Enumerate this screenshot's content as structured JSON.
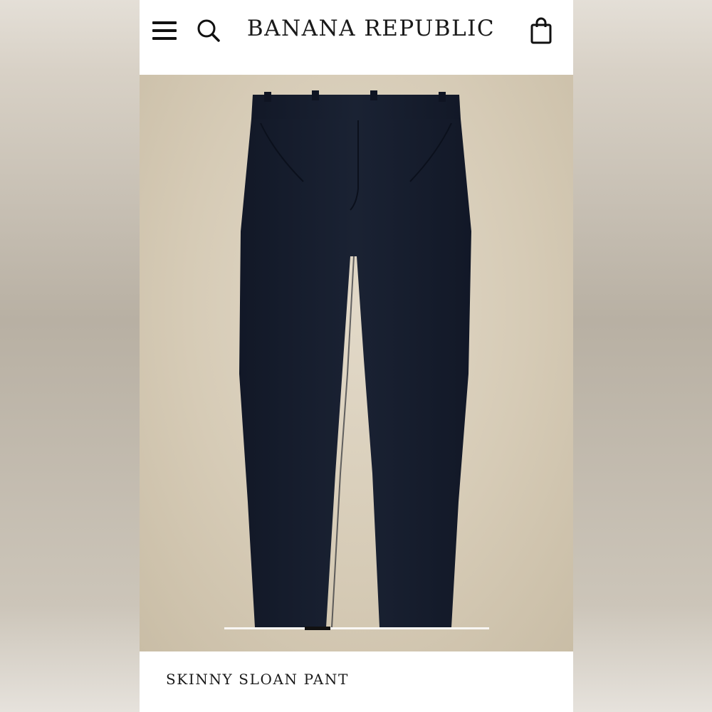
{
  "header": {
    "brand": "BANANA REPUBLIC",
    "menu_icon": "hamburger-menu-icon",
    "search_icon": "search-icon",
    "bag_icon": "shopping-bag-icon"
  },
  "product": {
    "title": "SKINNY SLOAN PANT",
    "image_alt": "navy skinny pants on beige background",
    "color": "#161c2b",
    "carousel": {
      "total_segments": 10,
      "active_index": 3
    }
  },
  "colors": {
    "background": "#ffffff",
    "text": "#1a1a1a",
    "photo_bg": "#d6cbb6",
    "pant": "#161c2b"
  }
}
